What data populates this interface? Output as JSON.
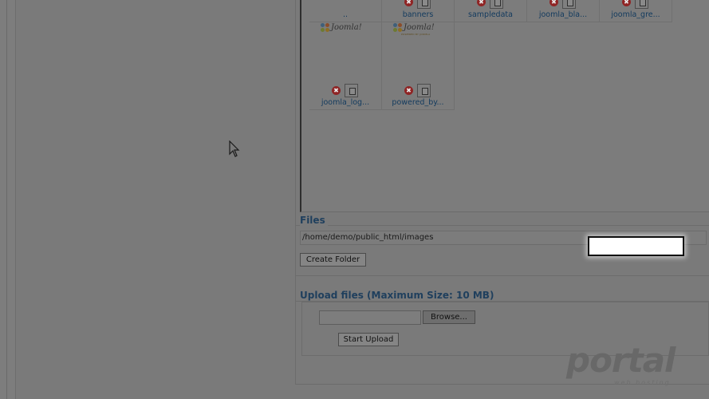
{
  "media_browser": {
    "top_row": [
      {
        "label": "..",
        "icon": "folder-up-icon"
      },
      {
        "label": "banners",
        "icon": "folder-icon"
      },
      {
        "label": "sampledata",
        "icon": "folder-icon"
      },
      {
        "label": "joomla_bla...",
        "icon": "folder-icon"
      },
      {
        "label": "joomla_gre...",
        "icon": "folder-icon"
      }
    ],
    "second_row": [
      {
        "label": "joomla_log...",
        "logo_text": "Joomla!"
      },
      {
        "label": "powered_by...",
        "logo_text": "Joomla!",
        "logo_sub": "POWERED BY JOOMLA"
      }
    ],
    "delete_glyph": "✖"
  },
  "files": {
    "legend": "Files",
    "path": "/home/demo/public_html/images",
    "create_folder_label": "Create Folder"
  },
  "upload": {
    "legend": "Upload files (Maximum Size: 10 MB)",
    "browse_label": "Browse...",
    "start_label": "Start Upload"
  },
  "watermark": {
    "text": "portal",
    "subtext": "web hosting"
  },
  "colors": {
    "legend": "#1f3f5d",
    "link": "#123a5e",
    "delete": "#8f2424",
    "overlay_bg": "#7a7a7a"
  }
}
